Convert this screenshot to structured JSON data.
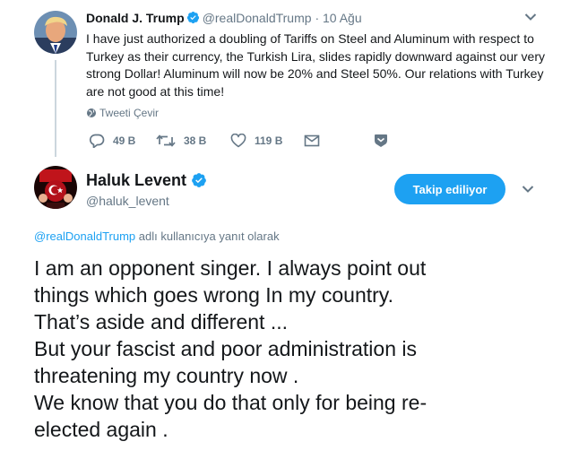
{
  "parent_tweet": {
    "author_name": "Donald J. Trump",
    "handle": "@realDonaldTrump",
    "separator": "·",
    "timestamp": "10 Ağu",
    "text": "I have just authorized a doubling of Tariffs on Steel and Aluminum with respect to Turkey as their currency, the Turkish Lira, slides rapidly downward against our very strong Dollar! Aluminum will now be 20% and Steel 50%. Our relations with Turkey are not good at this time!",
    "translate_label": "Tweeti Çevir",
    "reply_count": "49 B",
    "retweet_count": "38 B",
    "like_count": "119 B"
  },
  "reply_tweet": {
    "author_name": "Haluk Levent",
    "handle": "@haluk_levent",
    "follow_label": "Takip ediliyor",
    "replying_to_mention": "@realDonaldTrump",
    "replying_to_suffix": " adlı kullanıcıya yanıt olarak",
    "text_lines": [
      "I am an opponent singer. I always point out",
      "things which goes wrong In my country.",
      "That’s aside and different ...",
      "But your fascist and poor administration is",
      "threatening my country now .",
      "We know that you do that only for being re-",
      "elected again ."
    ]
  },
  "colors": {
    "accent": "#1da1f2",
    "secondary_text": "#657786",
    "primary_text": "#14171a",
    "thread_line": "#ccd6dd"
  },
  "icons": {
    "reply": "reply-icon",
    "retweet": "retweet-icon",
    "like": "heart-icon",
    "dm": "envelope-icon",
    "save": "bookmark-icon",
    "translate": "globe-icon",
    "verified": "verified-badge-icon",
    "more": "chevron-down-icon"
  }
}
